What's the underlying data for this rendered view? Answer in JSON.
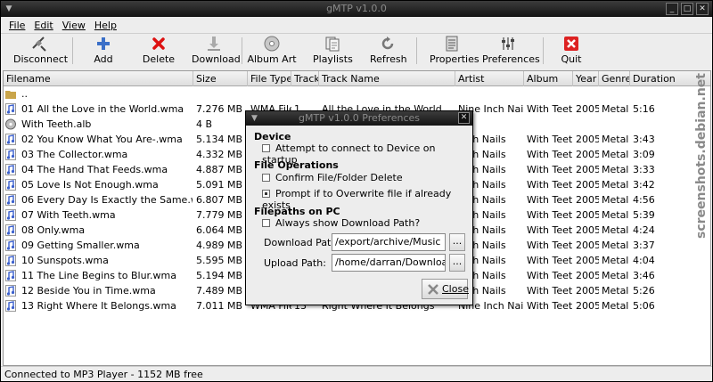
{
  "window": {
    "title": "gMTP v1.0.0"
  },
  "menu": [
    "File",
    "Edit",
    "View",
    "Help"
  ],
  "toolbar": [
    {
      "label": "Disconnect",
      "icon": "disconnect-icon"
    },
    {
      "label": "Add",
      "icon": "add-icon"
    },
    {
      "label": "Delete",
      "icon": "delete-icon"
    },
    {
      "label": "Download",
      "icon": "download-icon"
    },
    {
      "label": "Album Art",
      "icon": "album-art-icon"
    },
    {
      "label": "Playlists",
      "icon": "playlists-icon"
    },
    {
      "label": "Refresh",
      "icon": "refresh-icon"
    },
    {
      "label": "Properties",
      "icon": "properties-icon"
    },
    {
      "label": "Preferences",
      "icon": "preferences-icon"
    },
    {
      "label": "Quit",
      "icon": "quit-icon"
    }
  ],
  "columns": [
    "Filename",
    "Size",
    "File Type",
    "Track",
    "Track Name",
    "Artist",
    "Album",
    "Year",
    "Genre",
    "Duration"
  ],
  "rows": [
    {
      "icon": "folder",
      "filename": "..",
      "size": "",
      "type": "",
      "track": "",
      "name": "",
      "artist": "",
      "album": "",
      "year": "",
      "genre": "",
      "duration": ""
    },
    {
      "icon": "audio",
      "filename": "01 All the Love in the World.wma",
      "size": "7.276 MB",
      "type": "WMA File",
      "track": "1",
      "name": "All the Love in the World",
      "artist": "Nine Inch Nails",
      "album": "With Teeth",
      "year": "2005",
      "genre": "Metal",
      "duration": "5:16"
    },
    {
      "icon": "disc",
      "filename": "With Teeth.alb",
      "size": "4 B",
      "type": "",
      "track": "",
      "name": "",
      "artist": "",
      "album": "",
      "year": "",
      "genre": "",
      "duration": ""
    },
    {
      "icon": "audio",
      "filename": "02 You Know What You Are-.wma",
      "size": "5.134 MB",
      "type": "",
      "track": "",
      "name": "",
      "artist": "Inch Nails",
      "album": "With Teeth",
      "year": "2005",
      "genre": "Metal",
      "duration": "3:43"
    },
    {
      "icon": "audio",
      "filename": "03 The Collector.wma",
      "size": "4.332 MB",
      "type": "",
      "track": "",
      "name": "",
      "artist": "Inch Nails",
      "album": "With Teeth",
      "year": "2005",
      "genre": "Metal",
      "duration": "3:09"
    },
    {
      "icon": "audio",
      "filename": "04 The Hand That Feeds.wma",
      "size": "4.887 MB",
      "type": "",
      "track": "",
      "name": "",
      "artist": "Inch Nails",
      "album": "With Teeth",
      "year": "2005",
      "genre": "Metal",
      "duration": "3:33"
    },
    {
      "icon": "audio",
      "filename": "05 Love Is Not Enough.wma",
      "size": "5.091 MB",
      "type": "",
      "track": "",
      "name": "",
      "artist": "Inch Nails",
      "album": "With Teeth",
      "year": "2005",
      "genre": "Metal",
      "duration": "3:42"
    },
    {
      "icon": "audio",
      "filename": "06 Every Day Is Exactly the Same.wma",
      "size": "6.807 MB",
      "type": "",
      "track": "",
      "name": "",
      "artist": "Inch Nails",
      "album": "With Teeth",
      "year": "2005",
      "genre": "Metal",
      "duration": "4:56"
    },
    {
      "icon": "audio",
      "filename": "07 With Teeth.wma",
      "size": "7.779 MB",
      "type": "",
      "track": "",
      "name": "",
      "artist": "Inch Nails",
      "album": "With Teeth",
      "year": "2005",
      "genre": "Metal",
      "duration": "5:39"
    },
    {
      "icon": "audio",
      "filename": "08 Only.wma",
      "size": "6.064 MB",
      "type": "",
      "track": "",
      "name": "",
      "artist": "Inch Nails",
      "album": "With Teeth",
      "year": "2005",
      "genre": "Metal",
      "duration": "4:24"
    },
    {
      "icon": "audio",
      "filename": "09 Getting Smaller.wma",
      "size": "4.989 MB",
      "type": "",
      "track": "",
      "name": "",
      "artist": "Inch Nails",
      "album": "With Teeth",
      "year": "2005",
      "genre": "Metal",
      "duration": "3:37"
    },
    {
      "icon": "audio",
      "filename": "10 Sunspots.wma",
      "size": "5.595 MB",
      "type": "",
      "track": "",
      "name": "",
      "artist": "Inch Nails",
      "album": "With Teeth",
      "year": "2005",
      "genre": "Metal",
      "duration": "4:04"
    },
    {
      "icon": "audio",
      "filename": "11 The Line Begins to Blur.wma",
      "size": "5.194 MB",
      "type": "",
      "track": "",
      "name": "",
      "artist": "Inch Nails",
      "album": "With Teeth",
      "year": "2005",
      "genre": "Metal",
      "duration": "3:46"
    },
    {
      "icon": "audio",
      "filename": "12 Beside You in Time.wma",
      "size": "7.489 MB",
      "type": "",
      "track": "",
      "name": "",
      "artist": "Inch Nails",
      "album": "With Teeth",
      "year": "2005",
      "genre": "Metal",
      "duration": "5:26"
    },
    {
      "icon": "audio",
      "filename": "13 Right Where It Belongs.wma",
      "size": "7.011 MB",
      "type": "WMA File",
      "track": "13",
      "name": "Right Where It Belongs",
      "artist": "Nine Inch Nails",
      "album": "With Teeth",
      "year": "2005",
      "genre": "Metal",
      "duration": "5:06"
    }
  ],
  "status": "Connected to MP3 Player - 1152 MB free",
  "watermark": "screenshots.debian.net",
  "dialog": {
    "title": "gMTP v1.0.0 Preferences",
    "device_heading": "Device",
    "device_option": "Attempt to connect to Device on startup",
    "device_checked": false,
    "fileops_heading": "File Operations",
    "confirm_delete": "Confirm File/Folder Delete",
    "confirm_delete_checked": false,
    "prompt_overwrite": "Prompt if to Overwrite file if already exists",
    "prompt_overwrite_checked": true,
    "filepaths_heading": "Filepaths on PC",
    "always_show": "Always show Download Path?",
    "always_show_checked": false,
    "download_label": "Download Path:",
    "download_value": "/export/archive/Music",
    "upload_label": "Upload Path:",
    "upload_value": "/home/darran/Downloads",
    "browse_label": "...",
    "close_label": "Close"
  },
  "colors": {
    "titlebar": "#1e1e1e",
    "audio_icon": "#3a5fcd",
    "folder_icon": "#c9a54a",
    "delete_red": "#d11",
    "quit_red": "#d22"
  }
}
